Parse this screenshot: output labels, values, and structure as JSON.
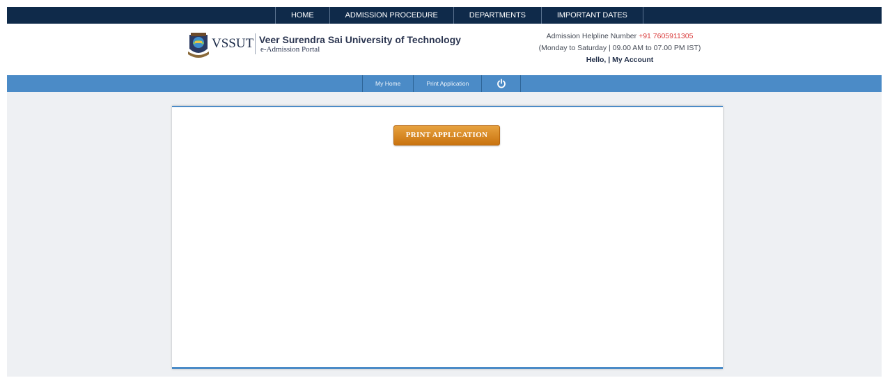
{
  "topnav": {
    "items": [
      {
        "label": "HOME"
      },
      {
        "label": "ADMISSION PROCEDURE"
      },
      {
        "label": "DEPARTMENTS"
      },
      {
        "label": "IMPORTANT DATES"
      }
    ]
  },
  "header": {
    "abbr": "VSSUT",
    "name": "Veer Surendra Sai University of Technology",
    "subtitle": "e-Admission Portal",
    "helpline_label": "Admission Helpline Number ",
    "helpline_number": "+91 7605911305",
    "hours": "(Monday to Saturday | 09.00 AM to 07.00 PM IST)",
    "greeting": "Hello, | ",
    "account_link": "My Account"
  },
  "subnav": {
    "items": [
      {
        "label": "My Home"
      },
      {
        "label": "Print Application"
      }
    ],
    "power_icon": "power-icon"
  },
  "main": {
    "print_button": "PRINT APPLICATION"
  },
  "colors": {
    "topnav_bg": "#0f2a4a",
    "subnav_bg": "#4b8bc7",
    "button_orange": "#d8891f",
    "helpline_red": "#d93a3a"
  }
}
